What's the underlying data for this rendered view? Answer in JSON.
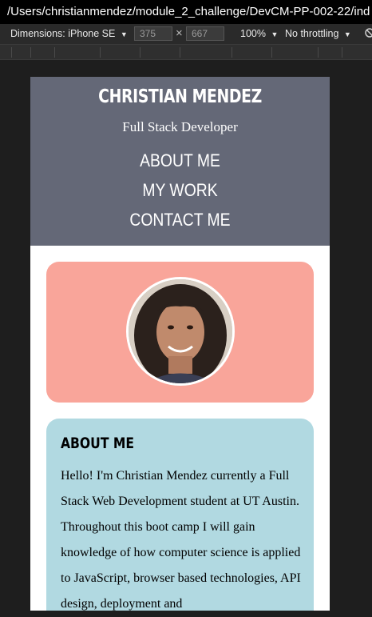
{
  "browser": {
    "url": "/Users/christianmendez/module_2_challenge/DevCM-PP-002-22/ind"
  },
  "devtools": {
    "dimensions_label": "Dimensions: iPhone SE",
    "width_value": "375",
    "height_value": "667",
    "times_symbol": "×",
    "zoom": "100%",
    "throttling": "No throttling",
    "caret": "▼"
  },
  "site": {
    "name": "CHRISTIAN MENDEZ",
    "tagline": "Full Stack Developer",
    "nav": [
      "ABOUT ME",
      "MY WORK",
      "CONTACT ME"
    ]
  },
  "about": {
    "title": "ABOUT ME",
    "text": "Hello! I'm Christian Mendez currently a Full Stack Web Development student at UT Austin. Throughout this boot camp I will gain knowledge of how computer science is applied to JavaScript, browser based technologies, API design, deployment and"
  },
  "colors": {
    "header_bg": "#646877",
    "photo_card_bg": "#f9a59a",
    "about_card_bg": "#b1d9e1"
  }
}
